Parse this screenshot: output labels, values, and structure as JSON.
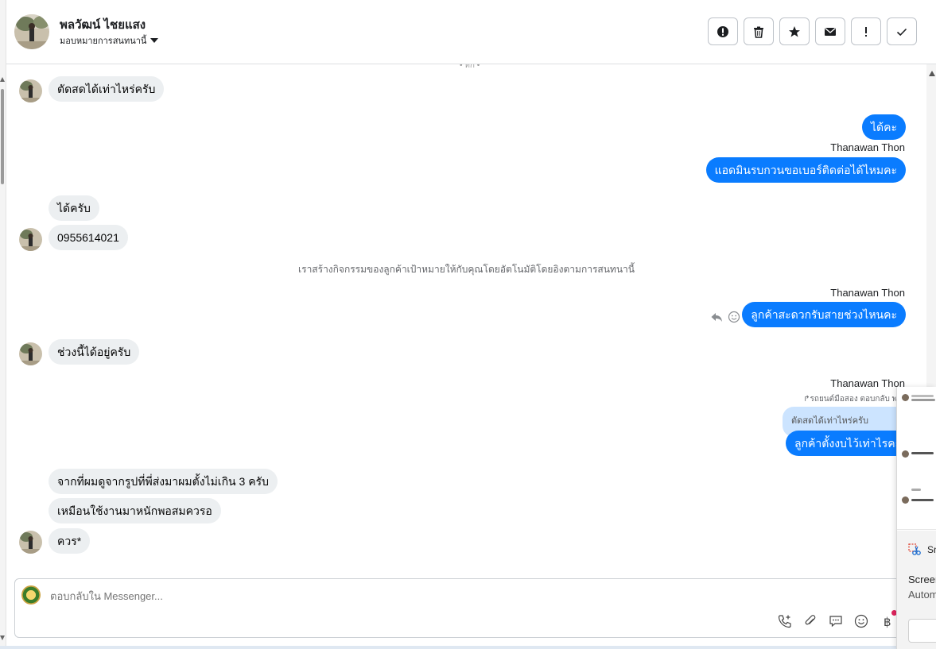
{
  "header": {
    "contact_name": "พลวัฒน์ ไชยแสง",
    "assign_label": "มอบหมายการสนทนานี้",
    "actions": [
      "spam-icon",
      "trash-icon",
      "star-icon",
      "mail-icon",
      "exclamation-icon",
      "check-icon"
    ]
  },
  "chat": {
    "date_label": "• ทก •",
    "messages": [
      {
        "side": "in",
        "text": "ตัดสดได้เท่าไหร่ครับ"
      },
      {
        "side": "out",
        "text": "ได้คะ"
      },
      {
        "side": "out",
        "sender": "Thanawan Thon",
        "text": "แอดมินรบกวนขอเบอร์ติดต่อได้ไหมคะ"
      },
      {
        "side": "in",
        "text": "ได้ครับ"
      },
      {
        "side": "in",
        "text": "0955614021"
      },
      {
        "side": "out",
        "sender": "Thanawan Thon",
        "text": "ลูกค้าสะดวกรับสายช่วงไหนคะ"
      },
      {
        "side": "in",
        "text": "ช่วงนี้ได้อยู่ครับ"
      },
      {
        "side": "out",
        "sender": "Thanawan Thon",
        "text": "ลูกค้าตั้งงบไว้เท่าไรคะ",
        "reply_meta": "รถยนต์มือสอง ตอบกลับ พลวั",
        "quoted": "ตัดสดได้เท่าไหร่ครับ"
      },
      {
        "side": "in",
        "text": "จากที่ผมดูจากรูปที่พี่ส่งมาผมตั้งไม่เกิน 3 ครับ"
      },
      {
        "side": "in",
        "text": "เหมือนใช้งานมาหนักพอสมควรอ"
      },
      {
        "side": "in",
        "text": "ควร*"
      }
    ],
    "system_note": "เราสร้างกิจกรรมของลูกค้าเป้าหมายให้กับคุณโดยอัตโนมัติโดยอิงตามการสนทนานี้"
  },
  "composer": {
    "placeholder": "ตอบกลับใน Messenger...",
    "tools": [
      "call-add-icon",
      "attachment-icon",
      "saved-reply-icon",
      "emoji-icon",
      "payment-icon"
    ]
  },
  "overlay": {
    "app_label": "Sn",
    "title": "Screen",
    "subtitle": "Autom"
  }
}
